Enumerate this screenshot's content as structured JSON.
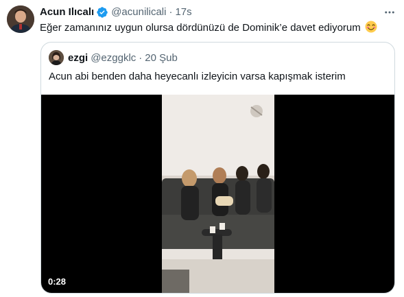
{
  "tweet": {
    "author": {
      "display_name": "Acun Ilıcalı",
      "handle": "@acunilicali",
      "verified": true
    },
    "separator": "·",
    "time": "17s",
    "text": "Eğer zamanınız uygun olursa dördünüzü de Dominik’e davet ediyorum",
    "text_emoji": "smiling-face-emoji",
    "more_icon": "more-horizontal-icon"
  },
  "quoted_tweet": {
    "author": {
      "display_name": "ezgi",
      "handle": "@ezggklc"
    },
    "separator": "·",
    "time": "20 Şub",
    "text": "Acun abi benden daha heyecanlı izleyicin varsa kapışmak isterim",
    "video": {
      "duration": "0:28"
    }
  },
  "colors": {
    "text_primary": "#0f1419",
    "text_secondary": "#536471",
    "verified_blue": "#1d9bf0",
    "border": "#cfd9de",
    "video_bg": "#000000"
  }
}
